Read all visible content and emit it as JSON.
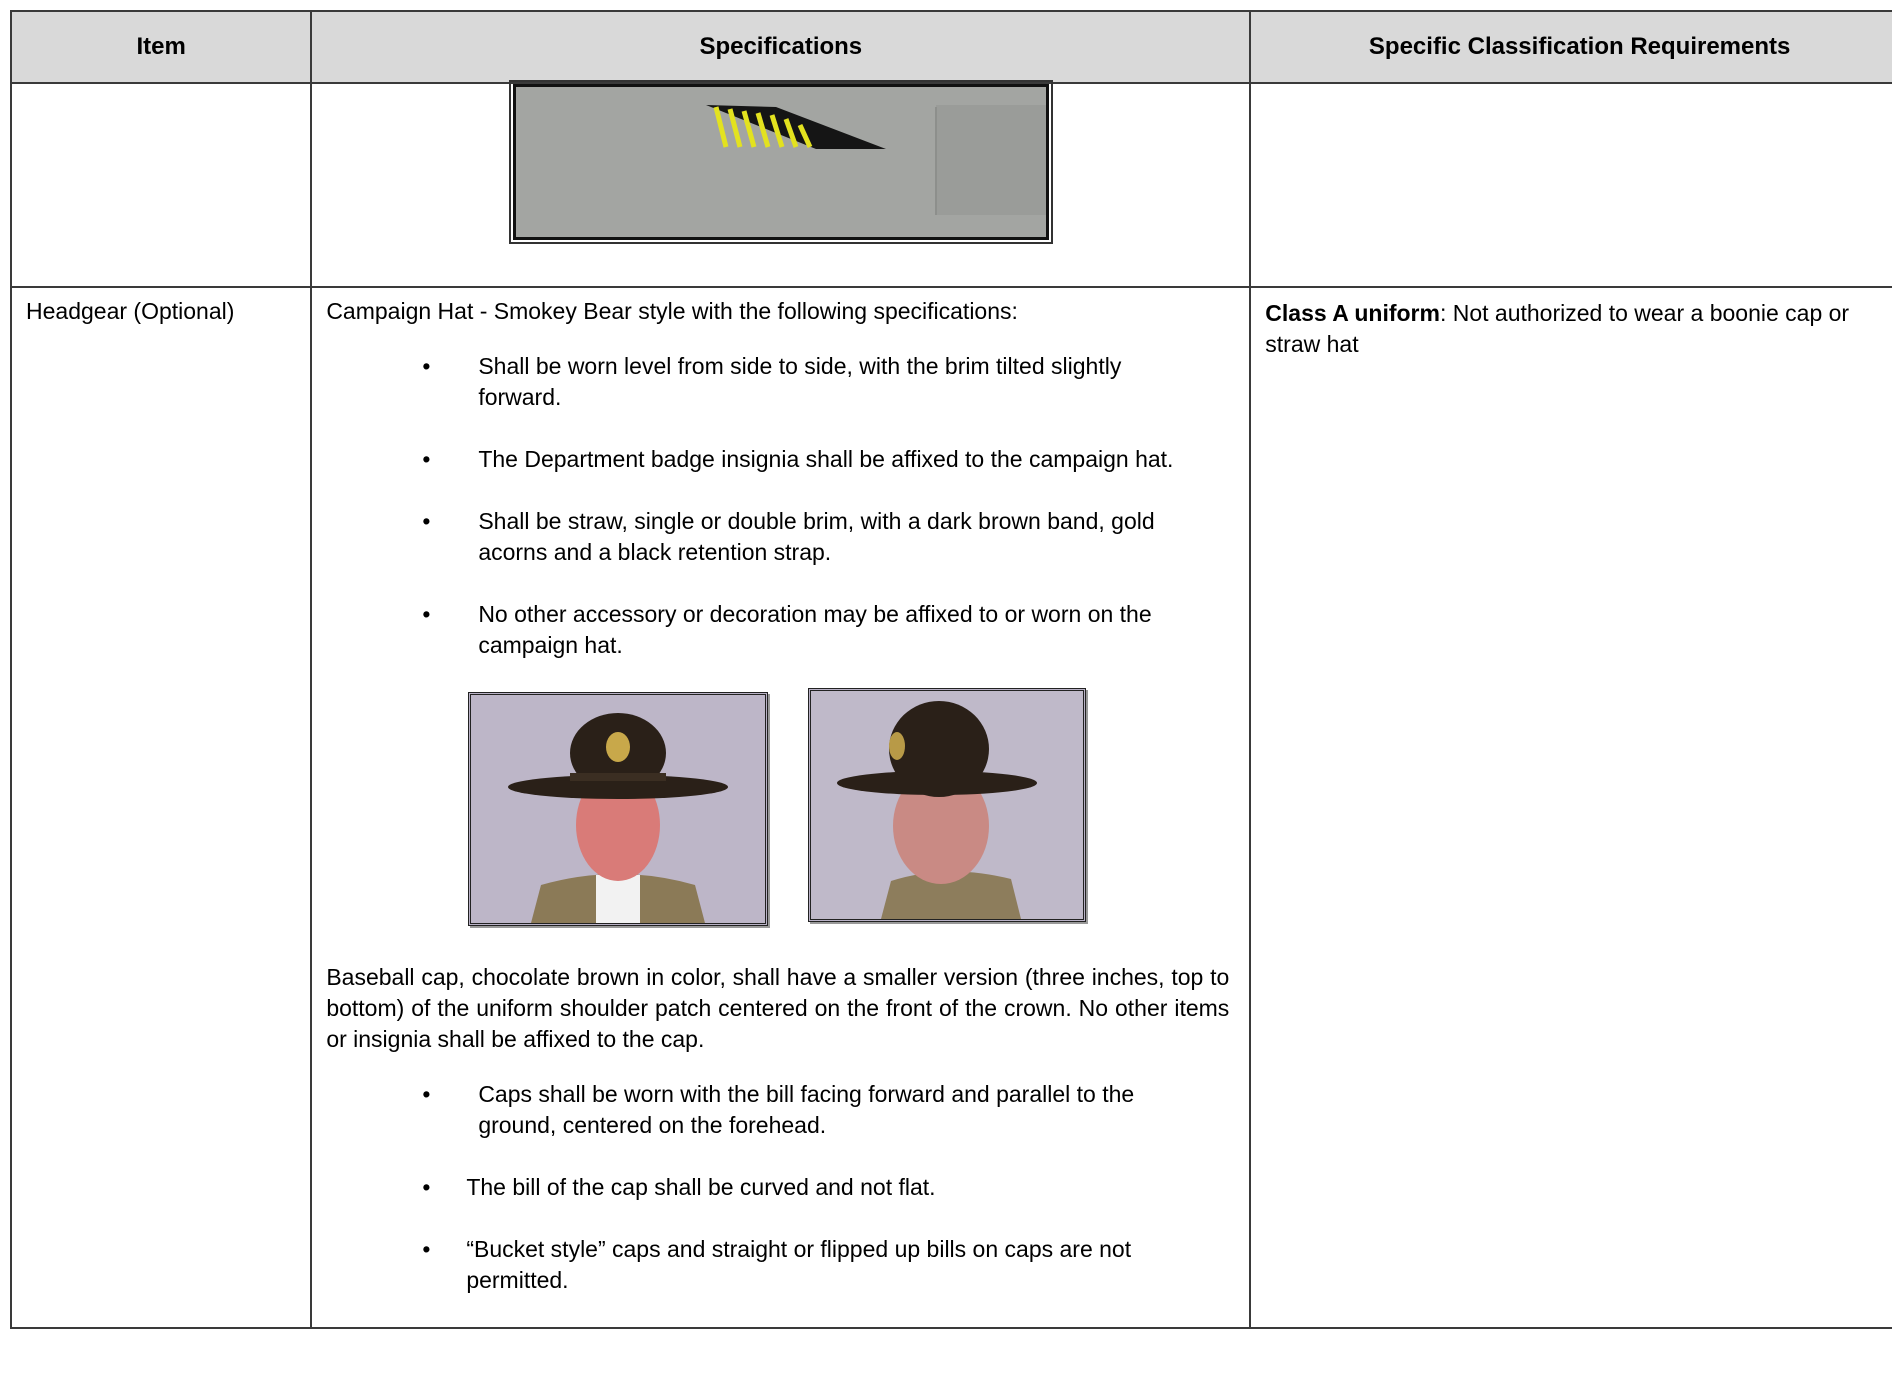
{
  "headers": {
    "item": "Item",
    "specifications": "Specifications",
    "requirements": "Specific Classification Requirements"
  },
  "row2": {
    "item": "Headgear (Optional)",
    "intro": "Campaign Hat -  Smokey Bear style with the following specifications:",
    "hat_bullets": [
      "Shall be worn level from side to side, with the brim tilted slightly forward.",
      "The Department badge insignia shall be affixed to the campaign hat.",
      "Shall be straw, single or double brim, with a dark brown band, gold acorns and a black retention strap.",
      "No other accessory or decoration may be affixed to or worn on the campaign hat."
    ],
    "baseball": "Baseball cap, chocolate brown in color, shall have a smaller version (three inches, top to bottom) of the uniform shoulder patch centered on the front of the crown. No other items or insignia shall be affixed to the cap.",
    "cap_bullets": [
      "Caps shall be worn with the bill facing forward and parallel to the ground, centered on the forehead.",
      "The bill of the cap shall be curved and not flat.",
      "“Bucket style” caps and straight or flipped up bills on caps are not permitted."
    ],
    "req_bold": "Class A uniform",
    "req_text": ":  Not authorized to wear a boonie cap or straw hat"
  },
  "colors": {
    "header_bg": "#d9d9d9",
    "stripe_yellow": "#e3e21f",
    "hat_brown": "#2a2018"
  }
}
